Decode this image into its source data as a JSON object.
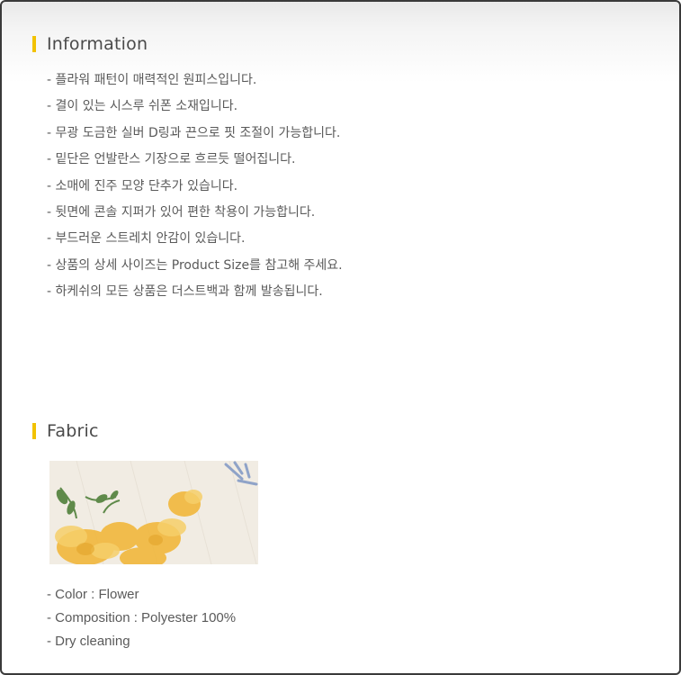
{
  "information": {
    "title": "Information",
    "items": [
      "- 플라워 패턴이 매력적인 원피스입니다.",
      "- 결이 있는 시스루 쉬폰 소재입니다.",
      "- 무광 도금한 실버 D링과 끈으로 핏 조절이 가능합니다.",
      "- 밑단은 언발란스 기장으로 흐르듯 떨어집니다.",
      "- 소매에 진주 모양 단추가 있습니다.",
      "- 뒷면에 콘솔 지퍼가 있어 편한 착용이 가능합니다.",
      "- 부드러운 스트레치 안감이 있습니다.",
      "- 상품의 상세 사이즈는 Product Size를 참고해 주세요.",
      "- 하케쉬의 모든 상품은 더스트백과 함께 발송됩니다."
    ]
  },
  "fabric": {
    "title": "Fabric",
    "swatch_colors": {
      "base": "#f1ece3",
      "petal": "#f1b73c",
      "petal_light": "#f6cf6a",
      "leaf": "#5f8a4a",
      "blue": "#7f97c4"
    },
    "items": [
      "- Color : Flower",
      "- Composition : Polyester 100%",
      "- Dry cleaning"
    ]
  },
  "accent_color": "#f2c200"
}
